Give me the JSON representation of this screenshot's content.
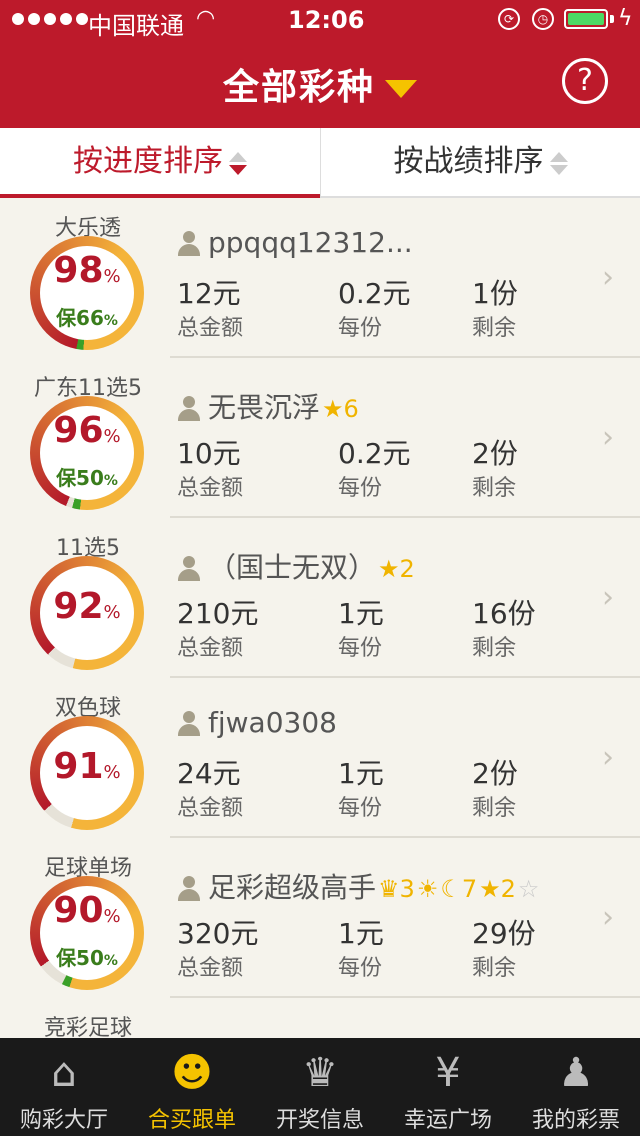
{
  "status": {
    "carrier": "中国联通",
    "time": "12:06"
  },
  "header": {
    "title": "全部彩种",
    "help": "?"
  },
  "sort_tabs": [
    {
      "label": "按进度排序",
      "active": true
    },
    {
      "label": "按战绩排序",
      "active": false
    }
  ],
  "captions": {
    "total": "总金额",
    "per": "每份",
    "left": "剩余"
  },
  "rows": [
    {
      "lottery": "大乐透",
      "progress": 98,
      "guarantee": 66,
      "progress_text": "98",
      "guarantee_text": "保66",
      "user": "ppqqq12312...",
      "badges": [],
      "total": "12元",
      "per": "0.2元",
      "left": "1份"
    },
    {
      "lottery": "广东11选5",
      "progress": 96,
      "guarantee": 50,
      "progress_text": "96",
      "guarantee_text": "保50",
      "user": "无畏沉浮",
      "badges": [
        "★6"
      ],
      "total": "10元",
      "per": "0.2元",
      "left": "2份"
    },
    {
      "lottery": "11选5",
      "progress": 92,
      "guarantee": 0,
      "progress_text": "92",
      "guarantee_text": "",
      "user": "（国士无双）",
      "badges": [
        "★2"
      ],
      "total": "210元",
      "per": "1元",
      "left": "16份"
    },
    {
      "lottery": "双色球",
      "progress": 91,
      "guarantee": 0,
      "progress_text": "91",
      "guarantee_text": "",
      "user": "fjwa0308",
      "badges": [],
      "total": "24元",
      "per": "1元",
      "left": "2份"
    },
    {
      "lottery": "足球单场",
      "progress": 90,
      "guarantee": 50,
      "progress_text": "90",
      "guarantee_text": "保50",
      "user": "足彩超级高手",
      "badges": [
        "♛3",
        "☀",
        "☾7",
        "★2",
        "☆"
      ],
      "total": "320元",
      "per": "1元",
      "left": "29份"
    },
    {
      "lottery": "竞彩足球",
      "progress": 0,
      "guarantee": 0,
      "progress_text": "",
      "guarantee_text": "",
      "user": "",
      "badges": [],
      "total": "",
      "per": "",
      "left": ""
    }
  ],
  "pct_sign": "%",
  "colors": {
    "brand": "#bd1a2b",
    "ring_red": "#b3182a",
    "ring_orange": "#f4b43a",
    "ring_green": "#3aa028",
    "accent": "#f5c300"
  },
  "tabbar": [
    {
      "label": "购彩大厅",
      "icon": "house-icon",
      "active": false
    },
    {
      "label": "合买跟单",
      "icon": "group-icon",
      "active": true
    },
    {
      "label": "开奖信息",
      "icon": "trophy-icon",
      "active": false
    },
    {
      "label": "幸运广场",
      "icon": "moneybag-icon",
      "active": false
    },
    {
      "label": "我的彩票",
      "icon": "person-icon",
      "active": false
    }
  ]
}
